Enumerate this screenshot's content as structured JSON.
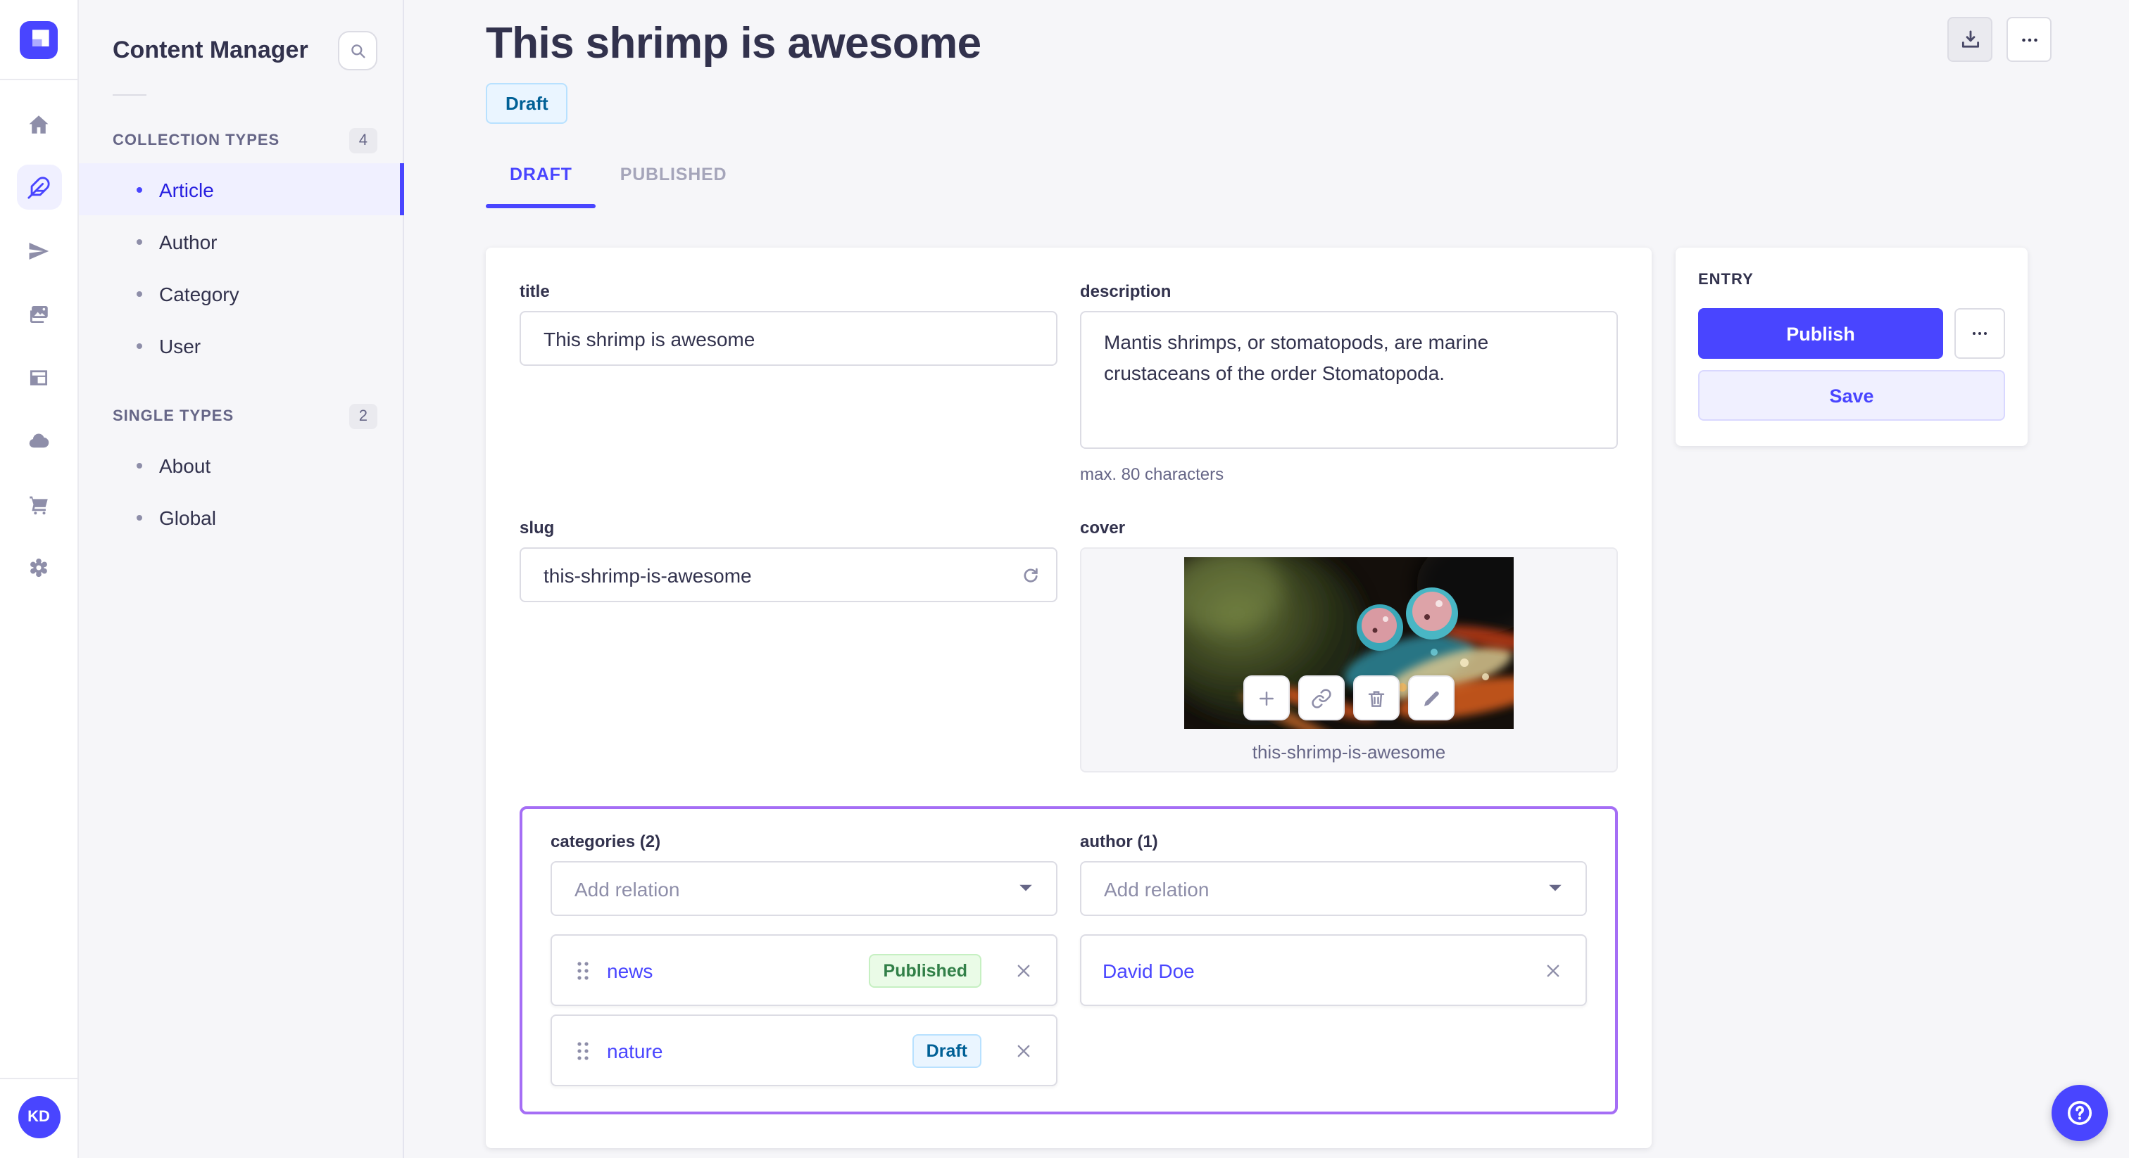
{
  "nav_rail": {
    "avatar_initials": "KD",
    "icons": [
      "home",
      "content-manager",
      "releases",
      "media-library",
      "content-type-builder",
      "deploy",
      "marketplace",
      "settings"
    ]
  },
  "sidebar": {
    "title": "Content Manager",
    "sections": [
      {
        "label": "COLLECTION TYPES",
        "count": "4",
        "items": [
          {
            "label": "Article",
            "active": true
          },
          {
            "label": "Author",
            "active": false
          },
          {
            "label": "Category",
            "active": false
          },
          {
            "label": "User",
            "active": false
          }
        ]
      },
      {
        "label": "SINGLE TYPES",
        "count": "2",
        "items": [
          {
            "label": "About",
            "active": false
          },
          {
            "label": "Global",
            "active": false
          }
        ]
      }
    ]
  },
  "header": {
    "title": "This shrimp is awesome",
    "status": "Draft"
  },
  "tabs": [
    {
      "label": "DRAFT",
      "active": true
    },
    {
      "label": "PUBLISHED",
      "active": false
    }
  ],
  "form": {
    "title": {
      "label": "title",
      "value": "This shrimp is awesome"
    },
    "description": {
      "label": "description",
      "value": "Mantis shrimps, or stomatopods, are marine crustaceans of the order Stomatopoda.",
      "hint": "max. 80 characters"
    },
    "slug": {
      "label": "slug",
      "value": "this-shrimp-is-awesome"
    },
    "cover": {
      "label": "cover",
      "caption": "this-shrimp-is-awesome"
    },
    "categories": {
      "label": "categories (2)",
      "placeholder": "Add relation",
      "items": [
        {
          "name": "news",
          "status": "Published"
        },
        {
          "name": "nature",
          "status": "Draft"
        }
      ]
    },
    "author": {
      "label": "author (1)",
      "placeholder": "Add relation",
      "items": [
        {
          "name": "David Doe"
        }
      ]
    }
  },
  "entry_panel": {
    "title": "ENTRY",
    "publish": "Publish",
    "save": "Save"
  },
  "colors": {
    "accent": "#4945ff",
    "active_link": "#271fe0",
    "relation_outline": "#a56ef5",
    "draft_badge": {
      "bg": "#eaf5ff",
      "border": "#b8e1ff",
      "text": "#006096"
    },
    "published_badge": {
      "bg": "#eafbe7",
      "border": "#c6f0c2",
      "text": "#328048"
    }
  }
}
